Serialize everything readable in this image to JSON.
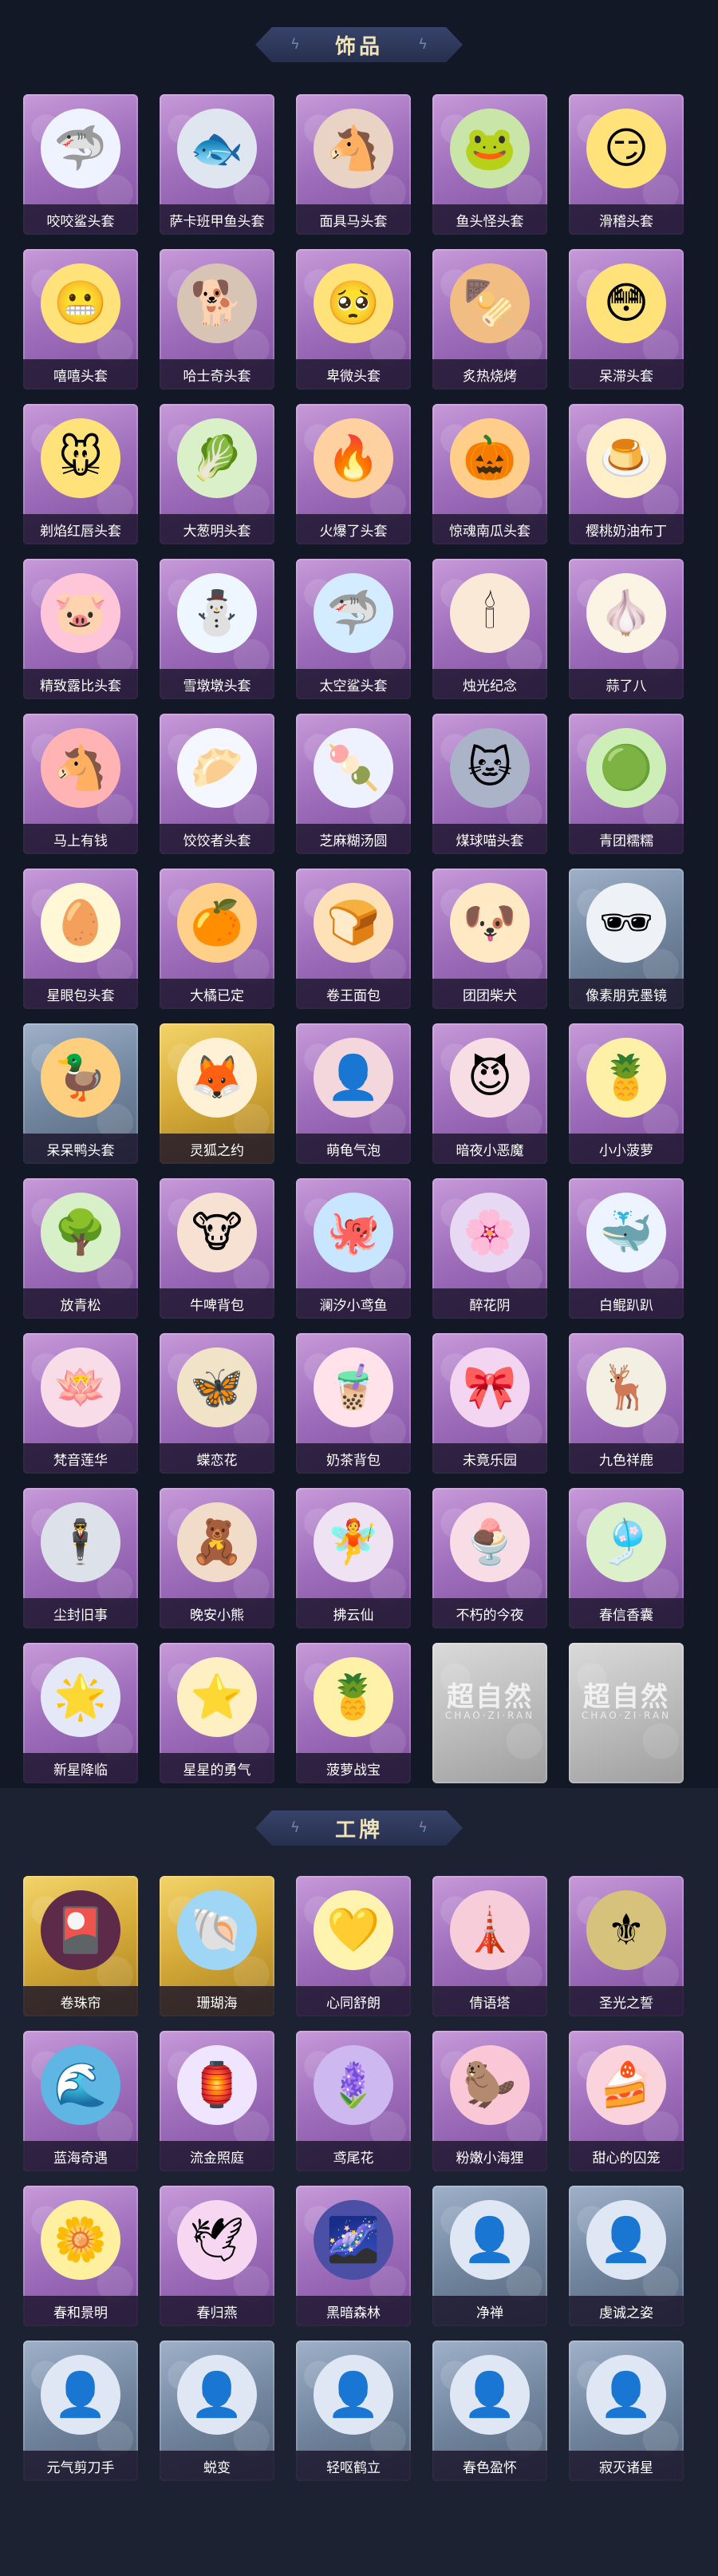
{
  "colors": {
    "card_purple": "#a070bd",
    "card_gold": "#d8ad3b",
    "card_blue": "#72869f",
    "card_silver": "#bdbdbd",
    "title_text": "#f0e3b8",
    "background": "#121826"
  },
  "section_ornament": "ϟ",
  "sections": {
    "accessories": {
      "title": "饰品",
      "items": [
        {
          "label": "咬咬鲨头套",
          "icon": "🦈",
          "bg": "#eef3ff",
          "tint": "purple"
        },
        {
          "label": "萨卡班甲鱼头套",
          "icon": "🐟",
          "bg": "#dfe6ef",
          "tint": "purple"
        },
        {
          "label": "面具马头套",
          "icon": "🐴",
          "bg": "#e8d3c4",
          "tint": "purple"
        },
        {
          "label": "鱼头怪头套",
          "icon": "🐸",
          "bg": "#c9e6a8",
          "tint": "purple"
        },
        {
          "label": "滑稽头套",
          "icon": "😏",
          "bg": "#ffe27a",
          "tint": "purple"
        },
        {
          "label": "嘻嘻头套",
          "icon": "😬",
          "bg": "#ffe27a",
          "tint": "purple"
        },
        {
          "label": "哈士奇头套",
          "icon": "🐕",
          "bg": "#d7c4b5",
          "tint": "purple"
        },
        {
          "label": "卑微头套",
          "icon": "🥺",
          "bg": "#ffe27a",
          "tint": "purple"
        },
        {
          "label": "炙热烧烤",
          "icon": "🍢",
          "bg": "#f1bd82",
          "tint": "purple"
        },
        {
          "label": "呆滞头套",
          "icon": "😳",
          "bg": "#ffe27a",
          "tint": "purple"
        },
        {
          "label": "剃焰红唇头套",
          "icon": "🐭",
          "bg": "#ffe27a",
          "tint": "purple"
        },
        {
          "label": "大葱明头套",
          "icon": "🥬",
          "bg": "#d9f0c9",
          "tint": "purple"
        },
        {
          "label": "火爆了头套",
          "icon": "🔥",
          "bg": "#ffd0a0",
          "tint": "purple"
        },
        {
          "label": "惊魂南瓜头套",
          "icon": "🎃",
          "bg": "#ffce8a",
          "tint": "purple"
        },
        {
          "label": "樱桃奶油布丁",
          "icon": "🍮",
          "bg": "#fff0c9",
          "tint": "purple"
        },
        {
          "label": "精致露比头套",
          "icon": "🐷",
          "bg": "#ffc6d9",
          "tint": "purple"
        },
        {
          "label": "雪墩墩头套",
          "icon": "⛄",
          "bg": "#eef6ff",
          "tint": "purple"
        },
        {
          "label": "太空鲨头套",
          "icon": "🦈",
          "bg": "#d4ecff",
          "tint": "purple"
        },
        {
          "label": "烛光纪念",
          "icon": "🕯",
          "bg": "#fbe9d8",
          "tint": "purple"
        },
        {
          "label": "蒜了八",
          "icon": "🧄",
          "bg": "#fbf3e3",
          "tint": "purple"
        },
        {
          "label": "马上有钱",
          "icon": "🐴",
          "bg": "#ffb3b3",
          "tint": "purple"
        },
        {
          "label": "饺饺者头套",
          "icon": "🥟",
          "bg": "#f4f7ff",
          "tint": "purple"
        },
        {
          "label": "芝麻糊汤圆",
          "icon": "🍡",
          "bg": "#eef2ff",
          "tint": "purple"
        },
        {
          "label": "煤球喵头套",
          "icon": "🐱",
          "bg": "#aab3c8",
          "tint": "purple"
        },
        {
          "label": "青团糯糯",
          "icon": "🟢",
          "bg": "#cdeeb6",
          "tint": "purple"
        },
        {
          "label": "星眼包头套",
          "icon": "🥚",
          "bg": "#fff7d6",
          "tint": "purple"
        },
        {
          "label": "大橘已定",
          "icon": "🍊",
          "bg": "#ffd08a",
          "tint": "purple"
        },
        {
          "label": "卷王面包",
          "icon": "🍞",
          "bg": "#ffe1b8",
          "tint": "purple"
        },
        {
          "label": "团团柴犬",
          "icon": "🐶",
          "bg": "#ffe9c4",
          "tint": "purple"
        },
        {
          "label": "像素朋克墨镜",
          "icon": "🕶",
          "bg": "#eef1f6",
          "tint": "blue"
        },
        {
          "label": "呆呆鸭头套",
          "icon": "🦆",
          "bg": "#ffcf80",
          "tint": "blue"
        },
        {
          "label": "灵狐之约",
          "icon": "🦊",
          "bg": "#fff1d6",
          "tint": "gold"
        },
        {
          "label": "萌龟气泡",
          "icon": "👤",
          "bg": "#f3d7dc",
          "tint": "purple"
        },
        {
          "label": "暗夜小恶魔",
          "icon": "😈",
          "bg": "#f7dde4",
          "tint": "purple"
        },
        {
          "label": "小小菠萝",
          "icon": "🍍",
          "bg": "#fff0a8",
          "tint": "purple"
        },
        {
          "label": "放青松",
          "icon": "🌳",
          "bg": "#d8f0c7",
          "tint": "purple"
        },
        {
          "label": "牛啤背包",
          "icon": "🐮",
          "bg": "#f7e1d2",
          "tint": "purple"
        },
        {
          "label": "澜汐小鸢鱼",
          "icon": "🐙",
          "bg": "#c8e6ff",
          "tint": "purple"
        },
        {
          "label": "醉花阴",
          "icon": "🌸",
          "bg": "#e7d9f3",
          "tint": "purple"
        },
        {
          "label": "白鲲趴趴",
          "icon": "🐳",
          "bg": "#eef4ff",
          "tint": "purple"
        },
        {
          "label": "梵音莲华",
          "icon": "🪷",
          "bg": "#f8dde8",
          "tint": "purple"
        },
        {
          "label": "蝶恋花",
          "icon": "🦋",
          "bg": "#f1e3c7",
          "tint": "purple"
        },
        {
          "label": "奶茶背包",
          "icon": "🧋",
          "bg": "#ffe2ea",
          "tint": "purple"
        },
        {
          "label": "未竟乐园",
          "icon": "🎀",
          "bg": "#f3d4f1",
          "tint": "purple"
        },
        {
          "label": "九色祥鹿",
          "icon": "🦌",
          "bg": "#f4efe3",
          "tint": "purple"
        },
        {
          "label": "尘封旧事",
          "icon": "🕴",
          "bg": "#dde1ea",
          "tint": "purple"
        },
        {
          "label": "晚安小熊",
          "icon": "🧸",
          "bg": "#f0dcc9",
          "tint": "purple"
        },
        {
          "label": "拂云仙",
          "icon": "🧚",
          "bg": "#efe2f3",
          "tint": "purple"
        },
        {
          "label": "不朽的今夜",
          "icon": "🍨",
          "bg": "#f9dde6",
          "tint": "purple"
        },
        {
          "label": "春信香囊",
          "icon": "🎐",
          "bg": "#ddf0cc",
          "tint": "purple"
        },
        {
          "label": "新星降临",
          "icon": "🌟",
          "bg": "#e5e8f7",
          "tint": "purple"
        },
        {
          "label": "星星的勇气",
          "icon": "⭐",
          "bg": "#fff0c4",
          "tint": "purple"
        },
        {
          "label": "菠萝战宝",
          "icon": "🍍",
          "bg": "#fff2a8",
          "tint": "purple"
        },
        {
          "label": "",
          "icon": "",
          "bg": "#c8c8c8",
          "tint": "silver",
          "watermark": "超自然",
          "watermark_sub": "CHAO·ZI·RAN"
        },
        {
          "label": "",
          "icon": "",
          "bg": "#c8c8c8",
          "tint": "silver",
          "watermark": "超自然",
          "watermark_sub": "CHAO·ZI·RAN"
        }
      ]
    },
    "badges": {
      "title": "工牌",
      "items": [
        {
          "label": "卷珠帘",
          "icon": "🎴",
          "bg": "#5d2a4a",
          "tint": "gold"
        },
        {
          "label": "珊瑚海",
          "icon": "🐚",
          "bg": "#9fd6f5",
          "tint": "gold"
        },
        {
          "label": "心同舒朗",
          "icon": "💛",
          "bg": "#fff3b0",
          "tint": "purple"
        },
        {
          "label": "倩语塔",
          "icon": "🗼",
          "bg": "#f6cdd9",
          "tint": "purple"
        },
        {
          "label": "圣光之誓",
          "icon": "⚜",
          "bg": "#d7c27c",
          "tint": "purple"
        },
        {
          "label": "蓝海奇遇",
          "icon": "🌊",
          "bg": "#5fb6e3",
          "tint": "purple"
        },
        {
          "label": "流金照庭",
          "icon": "🏮",
          "bg": "#efe5ff",
          "tint": "purple"
        },
        {
          "label": "鸢尾花",
          "icon": "🪻",
          "bg": "#cdb9ef",
          "tint": "purple"
        },
        {
          "label": "粉嫩小海狸",
          "icon": "🦫",
          "bg": "#f9c7d6",
          "tint": "purple"
        },
        {
          "label": "甜心的囚笼",
          "icon": "🍰",
          "bg": "#fbd3dc",
          "tint": "purple"
        },
        {
          "label": "春和景明",
          "icon": "🌼",
          "bg": "#fff0a0",
          "tint": "purple"
        },
        {
          "label": "春归燕",
          "icon": "🕊",
          "bg": "#f6d6f1",
          "tint": "purple"
        },
        {
          "label": "黑暗森林",
          "icon": "🌌",
          "bg": "#4b4fa6",
          "tint": "purple"
        },
        {
          "label": "净禅",
          "icon": "👤",
          "bg": "#dfe7f4",
          "tint": "blue"
        },
        {
          "label": "虔诚之姿",
          "icon": "👤",
          "bg": "#dfe7f4",
          "tint": "blue"
        },
        {
          "label": "元气剪刀手",
          "icon": "👤",
          "bg": "#dfe7f4",
          "tint": "blue"
        },
        {
          "label": "蜕变",
          "icon": "👤",
          "bg": "#dfe7f4",
          "tint": "blue"
        },
        {
          "label": "轻呕鹤立",
          "icon": "👤",
          "bg": "#dfe7f4",
          "tint": "blue"
        },
        {
          "label": "春色盈怀",
          "icon": "👤",
          "bg": "#dfe7f4",
          "tint": "blue"
        },
        {
          "label": "寂灭诸星",
          "icon": "👤",
          "bg": "#dfe7f4",
          "tint": "blue"
        }
      ]
    }
  }
}
